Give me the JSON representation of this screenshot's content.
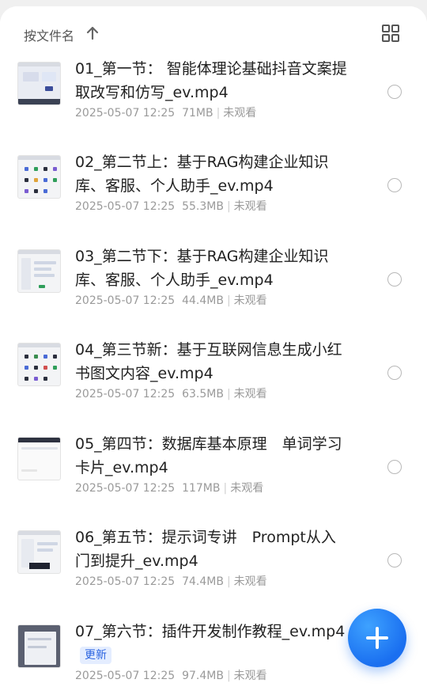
{
  "header": {
    "sort_label": "按文件名"
  },
  "files": [
    {
      "title": "01_第一节： 智能体理论基础抖音文案提取改写和仿写_ev.mp4",
      "date": "2025-05-07 12:25",
      "size": "71MB",
      "status": "未观看",
      "badge": ""
    },
    {
      "title": "02_第二节上：基于RAG构建企业知识库、客服、个人助手_ev.mp4",
      "date": "2025-05-07 12:25",
      "size": "55.3MB",
      "status": "未观看",
      "badge": ""
    },
    {
      "title": "03_第二节下：基于RAG构建企业知识库、客服、个人助手_ev.mp4",
      "date": "2025-05-07 12:25",
      "size": "44.4MB",
      "status": "未观看",
      "badge": ""
    },
    {
      "title": "04_第三节新：基于互联网信息生成小红书图文内容_ev.mp4",
      "date": "2025-05-07 12:25",
      "size": "63.5MB",
      "status": "未观看",
      "badge": ""
    },
    {
      "title": "05_第四节：数据库基本原理　单词学习卡片_ev.mp4",
      "date": "2025-05-07 12:25",
      "size": "117MB",
      "status": "未观看",
      "badge": ""
    },
    {
      "title": "06_第五节：提示词专讲　Prompt从入门到提升_ev.mp4",
      "date": "2025-05-07 12:25",
      "size": "74.4MB",
      "status": "未观看",
      "badge": ""
    },
    {
      "title": "07_第六节：插件开发制作教程_ev.mp4",
      "date": "2025-05-07 12:25",
      "size": "97.4MB",
      "status": "未观看",
      "badge": "更新"
    }
  ],
  "icons": {
    "sort": "arrow-up-icon",
    "view": "grid-view-icon",
    "fab": "plus-icon"
  },
  "colors": {
    "accent": "#1a6ff0",
    "badge_bg": "#e4edff",
    "badge_text": "#2a63e0"
  }
}
